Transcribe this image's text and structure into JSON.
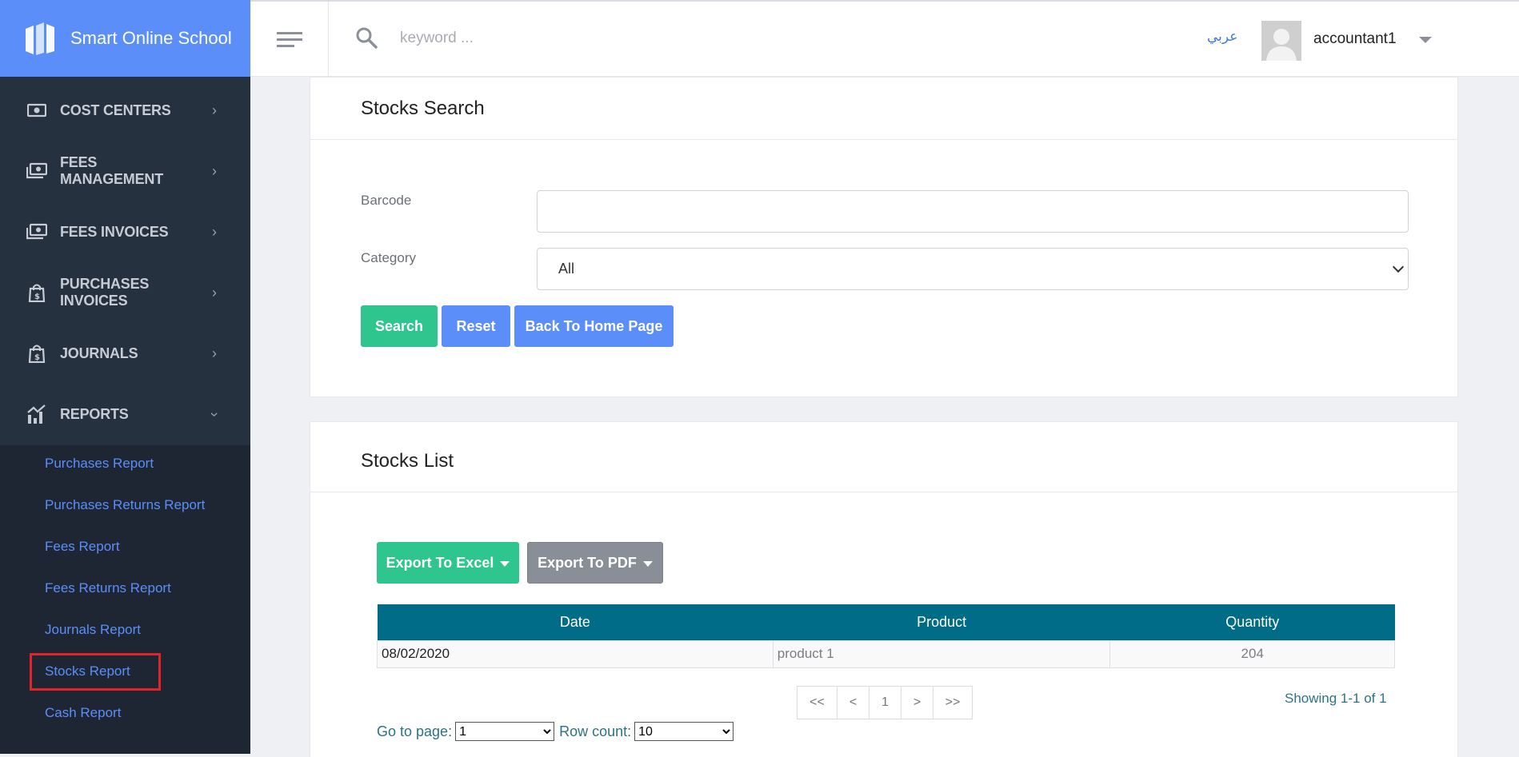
{
  "brand": {
    "name": "Smart Online School"
  },
  "sidebar": {
    "items": [
      {
        "label": "COST CENTERS",
        "icon": "money-icon"
      },
      {
        "label": "FEES MANAGEMENT",
        "icon": "money-stack-icon"
      },
      {
        "label": "FEES INVOICES",
        "icon": "money-stack-icon"
      },
      {
        "label": "PURCHASES INVOICES",
        "icon": "shopping-bag-icon"
      },
      {
        "label": "JOURNALS",
        "icon": "shopping-bag-icon"
      },
      {
        "label": "REPORTS",
        "icon": "chart-icon"
      }
    ],
    "reports_submenu": [
      "Purchases Report",
      "Purchases Returns Report",
      "Fees Report",
      "Fees Returns Report",
      "Journals Report",
      "Stocks Report",
      "Cash Report"
    ],
    "active_item": "Stocks Report"
  },
  "topbar": {
    "search_placeholder": "keyword ...",
    "language": "عربي",
    "username": "accountant1"
  },
  "search_panel": {
    "title": "Stocks Search",
    "barcode_label": "Barcode",
    "barcode_value": "",
    "category_label": "Category",
    "category_value": "All",
    "search_button": "Search",
    "reset_button": "Reset",
    "home_button": "Back To Home Page"
  },
  "list_panel": {
    "title": "Stocks List",
    "export_excel": "Export To Excel",
    "export_pdf": "Export To PDF",
    "columns": [
      "Date",
      "Product",
      "Quantity"
    ],
    "rows": [
      {
        "date": "08/02/2020",
        "product": "product 1",
        "quantity": "204"
      }
    ],
    "pager": {
      "first": "<<",
      "prev": "<",
      "current": "1",
      "next": ">",
      "last": ">>"
    },
    "showing": "Showing 1-1 of 1",
    "goto_label": "Go to page:",
    "goto_value": "1",
    "rowcount_label": "Row count:",
    "rowcount_value": "10"
  },
  "colors": {
    "sidebar_bg": "#263140",
    "brand_bg": "#5b8ef9",
    "green": "#2ec58e",
    "blue": "#5b8ef9",
    "table_header": "#006c87",
    "highlight": "#e2232a"
  }
}
